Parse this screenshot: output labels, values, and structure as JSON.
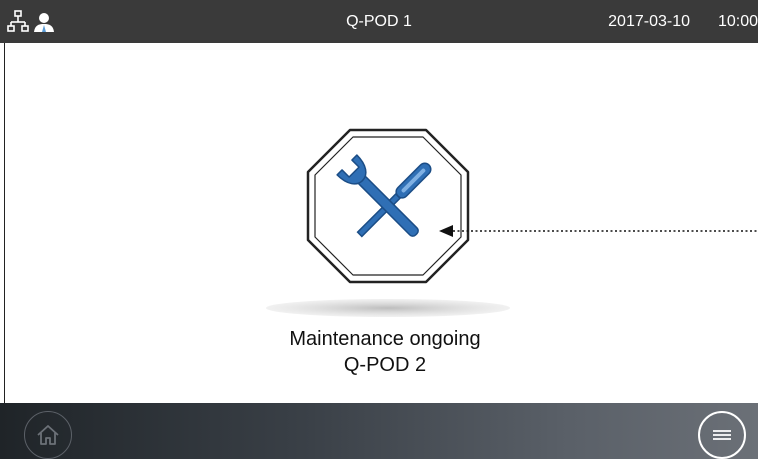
{
  "header": {
    "title": "Q-POD 1",
    "date": "2017-03-10",
    "time": "10:00",
    "icons": [
      "network-icon",
      "user-icon"
    ]
  },
  "main": {
    "status_icon": "maintenance-wrench-screwdriver-icon",
    "status_title": "Maintenance ongoing",
    "status_device": "Q-POD 2"
  },
  "footer": {
    "icons": [
      "home-icon",
      "menu-icon"
    ]
  },
  "colors": {
    "header_bg": "#3a3a3a",
    "tool_blue": "#2f6fb5",
    "footer_dark": "#1f2428",
    "footer_light": "#6b7077"
  }
}
